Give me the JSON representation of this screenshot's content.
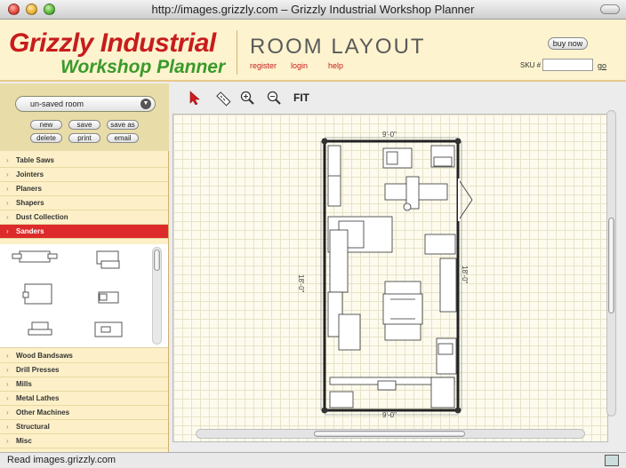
{
  "window": {
    "title": "http://images.grizzly.com – Grizzly Industrial Workshop Planner"
  },
  "header": {
    "logo_line1": "Grizzly Industrial",
    "logo_line2": "Workshop Planner",
    "section_title": "ROOM LAYOUT",
    "links": {
      "register": "register",
      "login": "login",
      "help": "help"
    },
    "buy_now": "buy now",
    "sku_label": "SKU #",
    "sku_value": "",
    "go": "go",
    "colors": {
      "brand_red": "#c81c1c",
      "brand_green": "#3a9a2a",
      "header_bg": "#fdf3cf"
    }
  },
  "room": {
    "selected": "un-saved room",
    "buttons": {
      "new": "new",
      "save": "save",
      "save_as": "save as",
      "delete": "delete",
      "print": "print",
      "email": "email"
    }
  },
  "categories_top": [
    {
      "label": "Table Saws",
      "active": false
    },
    {
      "label": "Jointers",
      "active": false
    },
    {
      "label": "Planers",
      "active": false
    },
    {
      "label": "Shapers",
      "active": false
    },
    {
      "label": "Dust Collection",
      "active": false
    },
    {
      "label": "Sanders",
      "active": true
    }
  ],
  "categories_bottom": [
    {
      "label": "Wood Bandsaws"
    },
    {
      "label": "Drill Presses"
    },
    {
      "label": "Mills"
    },
    {
      "label": "Metal Lathes"
    },
    {
      "label": "Other Machines"
    },
    {
      "label": "Structural"
    },
    {
      "label": "Misc"
    }
  ],
  "toolbar": {
    "tools": [
      "select-arrow-icon",
      "ruler-icon",
      "zoom-in-icon",
      "zoom-out-icon"
    ],
    "fit": "FIT"
  },
  "plan": {
    "dim_top": "9'-0\"",
    "dim_bottom": "9'-0\"",
    "dim_left": "18'-0\"",
    "dim_right": "18'-0\""
  },
  "status": {
    "text": "Read images.grizzly.com"
  }
}
